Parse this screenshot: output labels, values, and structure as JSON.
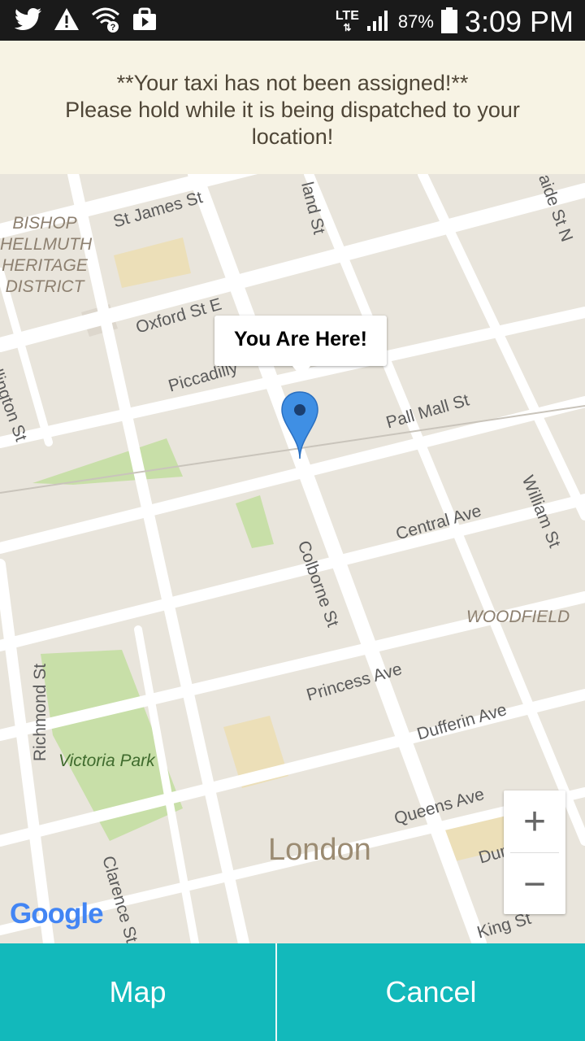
{
  "status_bar": {
    "network": "LTE",
    "battery": "87%",
    "time": "3:09 PM"
  },
  "banner": {
    "line1": "**Your taxi has not been assigned!**",
    "line2": "Please hold while it is being dispatched to your",
    "line3": "location!"
  },
  "map": {
    "callout": "You Are Here!",
    "streets": {
      "st_james": "St James St",
      "oxford": "Oxford St E",
      "piccadilly": "Piccadilly",
      "pall_mall": "Pall Mall St",
      "central": "Central Ave",
      "colborne": "Colborne St",
      "wellington": "Wellington St",
      "william": "William St",
      "princess": "Princess Ave",
      "dufferin": "Dufferin Ave",
      "queens": "Queens Ave",
      "dundas": "Dundas St",
      "king": "King St",
      "richmond": "Richmond St",
      "clarence": "Clarence St",
      "top_mid": "land St",
      "top_right": "aide St N"
    },
    "district_bishop": "BISHOP HELLMUTH HERITAGE DISTRICT",
    "district_woodfield": "WOODFIELD",
    "park": "Victoria Park",
    "city": "London",
    "attribution": "Google",
    "zoom_in": "+",
    "zoom_out": "−"
  },
  "bottom": {
    "map_label": "Map",
    "cancel_label": "Cancel"
  },
  "colors": {
    "accent": "#12b9bb",
    "banner_bg": "#f7f3e4",
    "pin": "#3f8fe4"
  }
}
